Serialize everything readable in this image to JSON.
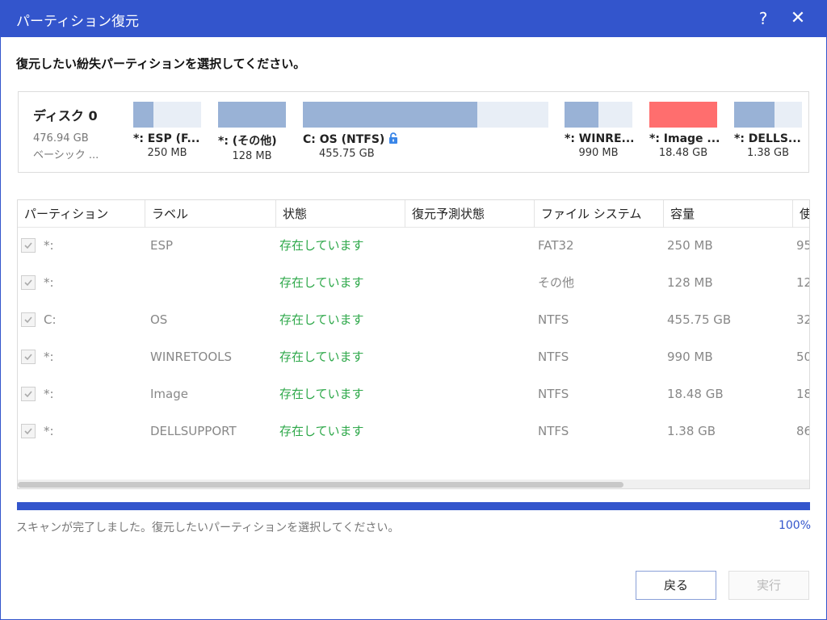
{
  "window": {
    "title": "パーティション復元",
    "help_glyph": "?",
    "close_glyph": "✕"
  },
  "instruction": "復元したい紛失パーティションを選択してください。",
  "disk": {
    "name": "ディスク 0",
    "size": "476.94 GB",
    "type": "ベーシック ...",
    "partitions": [
      {
        "name": "*: ESP (F...",
        "size": "250 MB",
        "used_fraction": 0.3,
        "color": "#99b2d6"
      },
      {
        "name": "*: (その他)",
        "size": "128 MB",
        "used_fraction": 1.0,
        "color": "#99b2d6"
      },
      {
        "name": "C: OS (NTFS)",
        "size": "455.75 GB",
        "used_fraction": 0.71,
        "color": "#99b2d6",
        "icon": "unlock-icon"
      },
      {
        "name": "*: WINRE...",
        "size": "990 MB",
        "used_fraction": 0.5,
        "color": "#99b2d6"
      },
      {
        "name": "*: Image ...",
        "size": "18.48 GB",
        "used_fraction": 1.0,
        "color": "#ff6e6e"
      },
      {
        "name": "*: DELLS...",
        "size": "1.38 GB",
        "used_fraction": 0.6,
        "color": "#99b2d6"
      }
    ]
  },
  "table": {
    "columns": [
      "パーティション",
      "ラベル",
      "状態",
      "復元予測状態",
      "ファイル システム",
      "容量",
      "使"
    ],
    "rows": [
      {
        "partition": "*:",
        "label": "ESP",
        "status": "存在しています",
        "predicted": "",
        "fs": "FAT32",
        "capacity": "250 MB",
        "used": "95"
      },
      {
        "partition": "*:",
        "label": "",
        "status": "存在しています",
        "predicted": "",
        "fs": "その他",
        "capacity": "128 MB",
        "used": "12"
      },
      {
        "partition": "C:",
        "label": "OS",
        "status": "存在しています",
        "predicted": "",
        "fs": "NTFS",
        "capacity": "455.75 GB",
        "used": "32"
      },
      {
        "partition": "*:",
        "label": "WINRETOOLS",
        "status": "存在しています",
        "predicted": "",
        "fs": "NTFS",
        "capacity": "990 MB",
        "used": "50"
      },
      {
        "partition": "*:",
        "label": "Image",
        "status": "存在しています",
        "predicted": "",
        "fs": "NTFS",
        "capacity": "18.48 GB",
        "used": "18"
      },
      {
        "partition": "*:",
        "label": "DELLSUPPORT",
        "status": "存在しています",
        "predicted": "",
        "fs": "NTFS",
        "capacity": "1.38 GB",
        "used": "86"
      }
    ]
  },
  "progress": {
    "value_percent": 100,
    "label": "100%",
    "message": "スキャンが完了しました。復元したいパーティションを選択してください。"
  },
  "buttons": {
    "back": "戻る",
    "run": "実行"
  },
  "colors": {
    "accent": "#3355cc",
    "status_ok": "#2ea84a",
    "partition_bar": "#99b2d6",
    "partition_highlight": "#ff6e6e"
  }
}
